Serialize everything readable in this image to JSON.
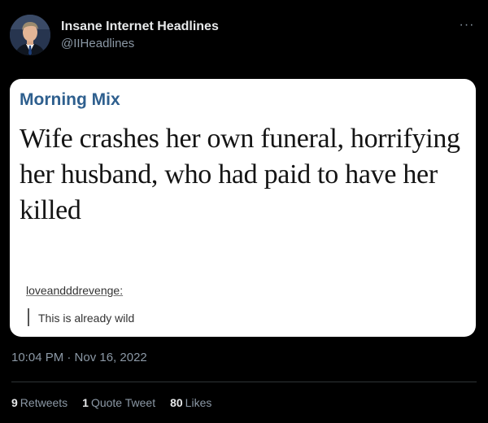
{
  "author": {
    "display_name": "Insane Internet Headlines",
    "handle": "@IIHeadlines"
  },
  "more_icon": "more-horizontal-icon",
  "media": {
    "section": "Morning Mix",
    "headline": "Wife crashes her own funeral, horrifying her husband, who had paid to have her killed",
    "post_user": "loveandddrevenge:",
    "post_quote": "This is already wild"
  },
  "timestamp": "10:04 PM · Nov 16, 2022",
  "stats": {
    "retweets_count": "9",
    "retweets_label": "Retweets",
    "quotes_count": "1",
    "quotes_label": "Quote Tweet",
    "likes_count": "80",
    "likes_label": "Likes"
  },
  "colors": {
    "background": "#000000",
    "primary_text": "#e7e9ea",
    "secondary_text": "#8b98a5",
    "section_blue": "#2e5f8e"
  }
}
